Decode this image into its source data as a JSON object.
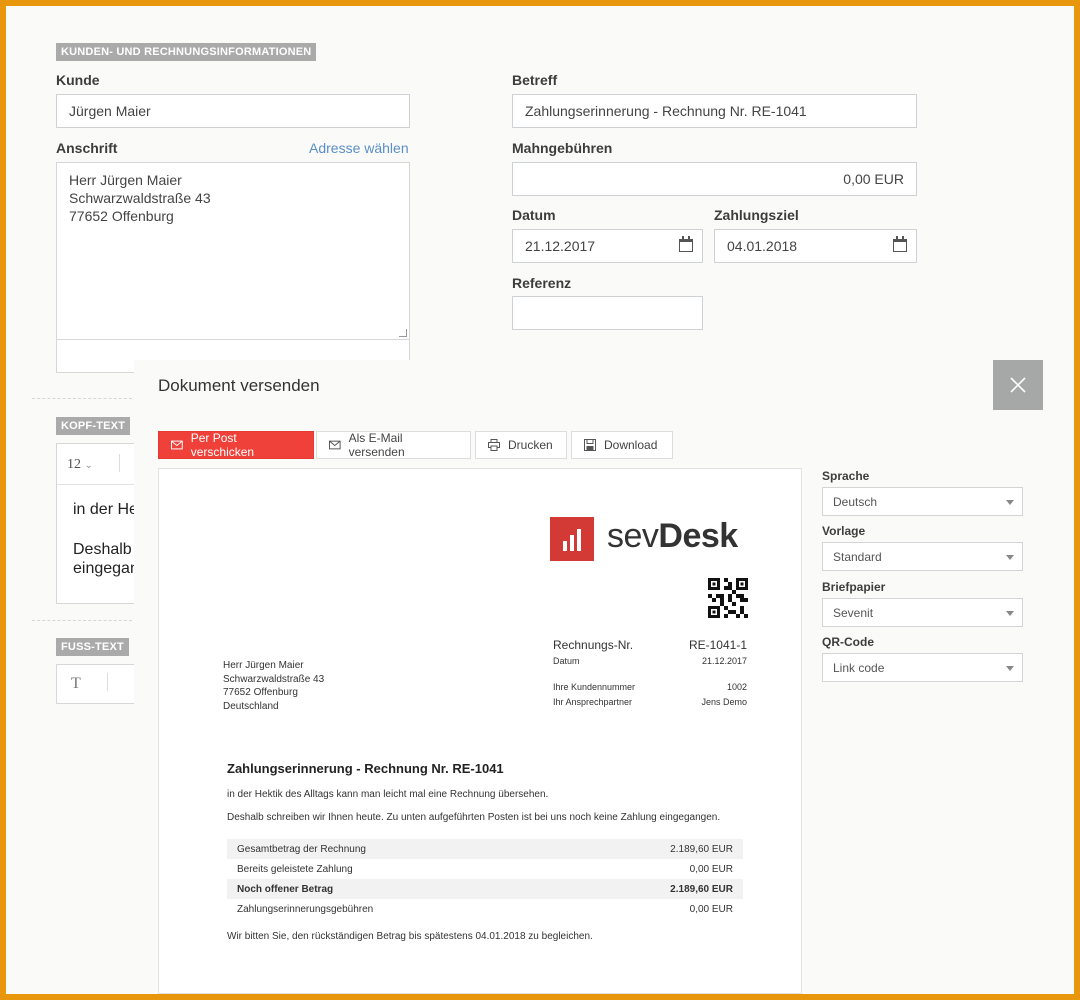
{
  "form": {
    "section_title": "KUNDEN- UND RECHNUNGSINFORMATIONEN",
    "kunde_label": "Kunde",
    "kunde_value": "Jürgen Maier",
    "anschrift_label": "Anschrift",
    "adresse_link": "Adresse wählen",
    "anschrift_lines": [
      "Herr Jürgen Maier",
      "Schwarzwaldstraße 43",
      "77652 Offenburg"
    ],
    "betreff_label": "Betreff",
    "betreff_value": "Zahlungserinnerung - Rechnung Nr. RE-1041",
    "mahngebuehren_label": "Mahngebühren",
    "mahngebuehren_value": "0,00 EUR",
    "datum_label": "Datum",
    "datum_value": "21.12.2017",
    "zahlungsziel_label": "Zahlungsziel",
    "zahlungsziel_value": "04.01.2018",
    "referenz_label": "Referenz",
    "referenz_value": ""
  },
  "kopf": {
    "tag": "KOPF-TEXT",
    "font_size": "12",
    "line1": "in der He",
    "line2": "Deshalb",
    "line3": "eingegan"
  },
  "fuss": {
    "tag": "FUSS-TEXT",
    "glyph": "T"
  },
  "modal": {
    "title": "Dokument versenden",
    "buttons": {
      "post": "Per Post verschicken",
      "email": "Als E-Mail versenden",
      "print": "Drucken",
      "download": "Download"
    }
  },
  "options": {
    "sprache_label": "Sprache",
    "sprache_value": "Deutsch",
    "vorlage_label": "Vorlage",
    "vorlage_value": "Standard",
    "briefpapier_label": "Briefpapier",
    "briefpapier_value": "Sevenit",
    "qr_label": "QR-Code",
    "qr_value": "Link code"
  },
  "document": {
    "brand": {
      "sev": "sev",
      "desk": "Desk",
      "color": "#d33a36"
    },
    "address": [
      "Herr Jürgen Maier",
      "Schwarzwaldstraße 43",
      "77652 Offenburg",
      "Deutschland"
    ],
    "meta": {
      "rechnungsnr_label": "Rechnungs-Nr.",
      "rechnungsnr_value": "RE-1041-1",
      "datum_label": "Datum",
      "datum_value": "21.12.2017",
      "kundennr_label": "Ihre Kundennummer",
      "kundennr_value": "1002",
      "ansprech_label": "Ihr Ansprechpartner",
      "ansprech_value": "Jens Demo"
    },
    "heading": "Zahlungserinnerung - Rechnung Nr. RE-1041",
    "para1": "in der Hektik des Alltags kann man leicht mal eine Rechnung übersehen.",
    "para2": "Deshalb schreiben wir Ihnen heute. Zu unten aufgeführten Posten ist bei uns noch keine Zahlung eingegangen.",
    "rows": [
      {
        "label": "Gesamtbetrag der Rechnung",
        "value": "2.189,60 EUR"
      },
      {
        "label": "Bereits geleistete Zahlung",
        "value": "0,00 EUR"
      },
      {
        "label": "Noch offener Betrag",
        "value": "2.189,60 EUR"
      },
      {
        "label": "Zahlungserinnerungsgebühren",
        "value": "0,00 EUR"
      }
    ],
    "closing": "Wir bitten Sie, den rückständigen Betrag bis spätestens 04.01.2018 zu begleichen."
  }
}
